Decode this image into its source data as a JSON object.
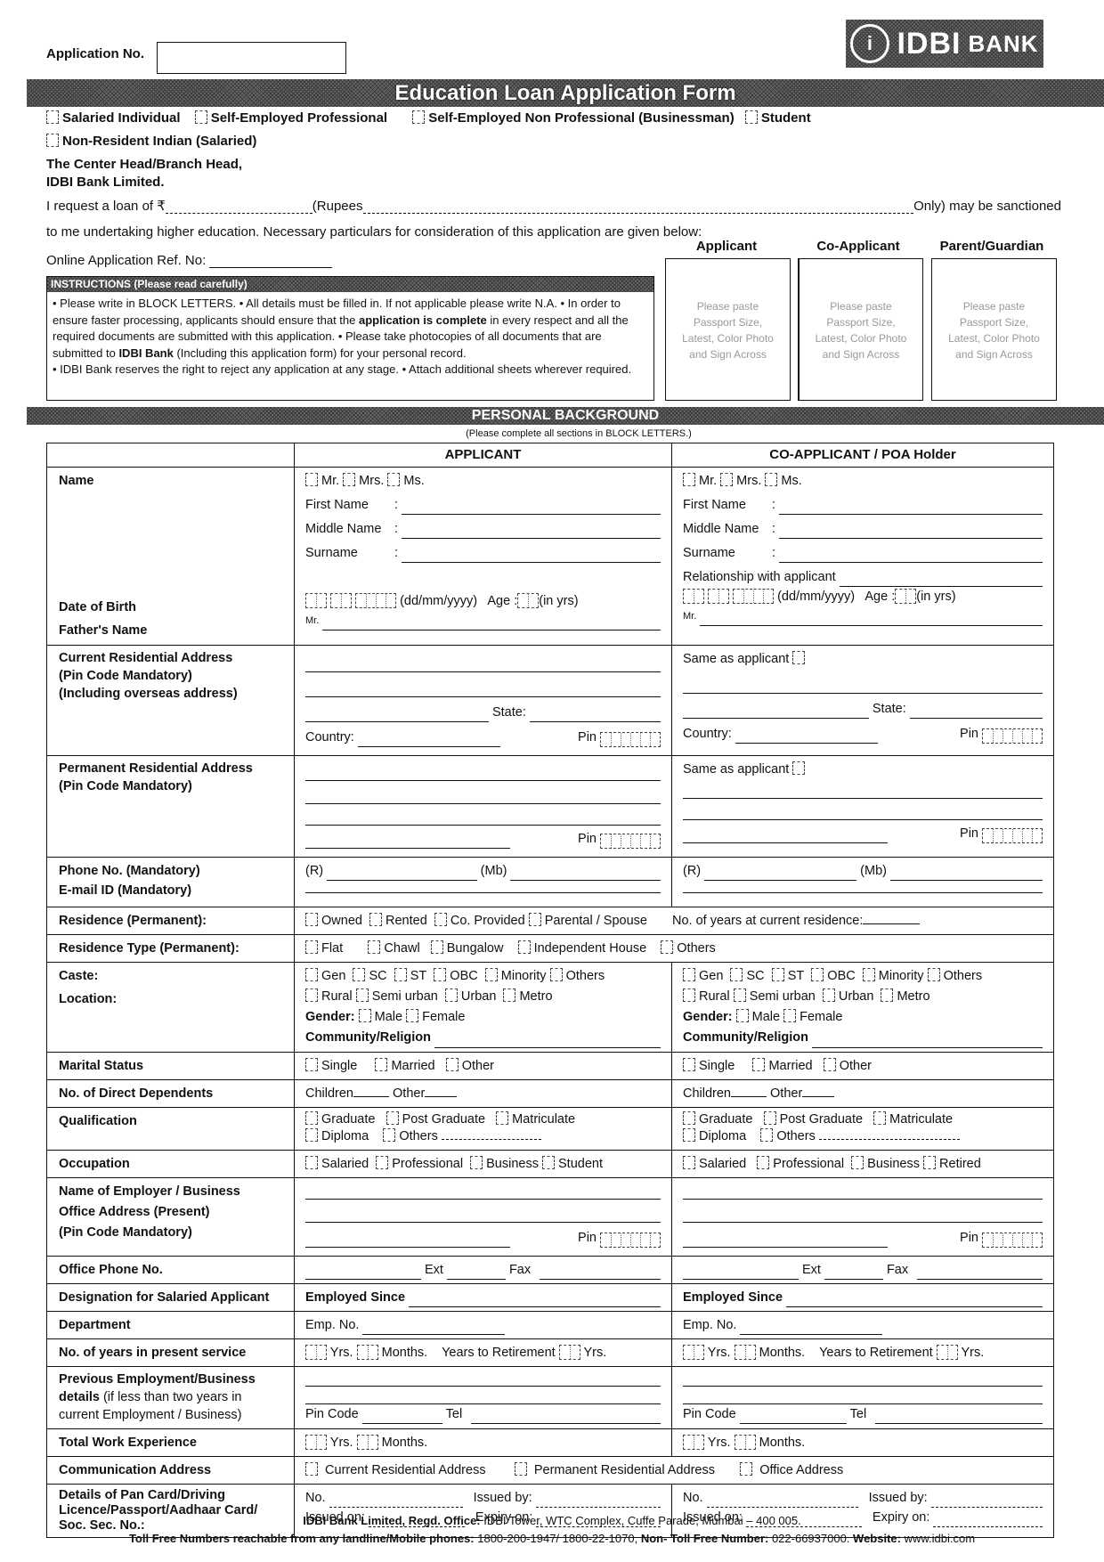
{
  "header": {
    "application_no_label": "Application No.",
    "logo_text": "IDBI",
    "logo_suffix": "BANK",
    "title": "Education Loan Application Form"
  },
  "applicant_types": [
    "Salaried Individual",
    "Self-Employed Professional",
    "Self-Employed Non Professional (Businessman)",
    "Student",
    "Non-Resident Indian (Salaried)"
  ],
  "addressee": {
    "line1": "The Center Head/Branch Head,",
    "line2": "IDBI Bank Limited."
  },
  "request": {
    "part1": "I request a loan of ₹",
    "part2": "(Rupees",
    "part3": "Only) may be sanctioned",
    "line2": "to me undertaking higher education. Necessary particulars for consideration of this application are given below:",
    "online_ref_label": "Online Application Ref. No:"
  },
  "photos": {
    "headers": [
      "Applicant",
      "Co-Applicant",
      "Parent/Guardian"
    ],
    "lines": [
      "Please paste",
      "Passport Size,",
      "Latest, Color Photo",
      "and Sign Across"
    ]
  },
  "instructions": {
    "title": "INSTRUCTIONS (Please read carefully)",
    "p1": "• Please write in BLOCK LETTERS. • All details must be filled in. If not applicable please write N.A. • In order to ensure faster processing, applicants should ensure that the ",
    "p1_bold": "application is complete",
    "p2": " in every respect and all the required documents are submitted with this application. • Please take photocopies of all documents that are submitted to ",
    "p2_bold": "IDBI Bank",
    "p3": " (Including this application form) for your personal record.",
    "p4": "• IDBI Bank reserves the right to reject any application at any stage.  • Attach additional sheets wherever required."
  },
  "section": {
    "title": "PERSONAL BACKGROUND",
    "note": "(Please complete all sections in BLOCK LETTERS.)"
  },
  "table": {
    "col_applicant": "APPLICANT",
    "col_coapplicant": "CO-APPLICANT / POA Holder",
    "labels": {
      "name": "Name",
      "dob": "Date of Birth",
      "father": "Father's Name",
      "cur_addr1": "Current Residential Address",
      "cur_addr2": "(Pin Code Mandatory)",
      "cur_addr3": "(Including overseas address)",
      "perm_addr1": "Permanent Residential Address",
      "perm_addr2": "(Pin Code Mandatory)",
      "phone": "Phone No. (Mandatory)",
      "email": "E-mail ID   (Mandatory)",
      "residence": "Residence (Permanent):",
      "residence_type": "Residence Type (Permanent):",
      "caste": "Caste:",
      "location": "Location:",
      "marital": "Marital Status",
      "dependents": "No. of Direct Dependents",
      "qualification": "Qualification",
      "occupation": "Occupation",
      "employer1": "Name of Employer / Business",
      "employer2": "Office Address (Present)",
      "employer3": "(Pin Code Mandatory)",
      "office_phone": "Office Phone No.",
      "designation": "Designation for Salaried Applicant",
      "department": "Department",
      "years_service": "No. of years in present service",
      "prev1": "Previous Employment/Business",
      "prev2_bold": "details",
      "prev2": " (if less than two years in",
      "prev3": "current Employment / Business)",
      "total_exp": "Total Work Experience",
      "comm_addr": "Communication Address",
      "pan1": "Details of Pan Card/Driving",
      "pan2": "Licence/Passport/Aadhaar Card/",
      "pan3": "Soc. Sec. No.:"
    },
    "fields": {
      "titles": [
        "Mr.",
        "Mrs.",
        "Ms."
      ],
      "first_name": "First Name",
      "middle_name": "Middle Name",
      "surname": "Surname",
      "colon": ":",
      "relationship": "Relationship with applicant",
      "date_format": "(dd/mm/yyyy)",
      "age": "Age :",
      "in_yrs": "(in yrs)",
      "mr": "Mr.",
      "state": "State:",
      "country": "Country:",
      "pin": "Pin",
      "same_as_applicant": "Same as applicant",
      "r": "(R)",
      "mb": "(Mb)",
      "residence_opts": [
        "Owned",
        "Rented",
        "Co. Provided",
        "Parental / Spouse"
      ],
      "years_residence": "No. of years at current residence:",
      "residence_type_opts": [
        "Flat",
        "Chawl",
        "Bungalow",
        "Independent House",
        "Others"
      ],
      "caste_opts": [
        "Gen",
        "SC",
        "ST",
        "OBC",
        "Minority",
        "Others"
      ],
      "location_opts": [
        "Rural",
        "Semi urban",
        "Urban",
        "Metro"
      ],
      "gender": "Gender:",
      "gender_opts": [
        "Male",
        "Female"
      ],
      "community": "Community/Religion",
      "marital_opts": [
        "Single",
        "Married",
        "Other"
      ],
      "children": "Children",
      "other": "Other",
      "qual_opts": [
        "Graduate",
        "Post Graduate",
        "Matriculate",
        "Diploma",
        "Others"
      ],
      "occ_applicant": [
        "Salaried",
        "Professional",
        "Business",
        "Student"
      ],
      "occ_coapplicant": [
        "Salaried",
        "Professional",
        "Business",
        "Retired"
      ],
      "ext": "Ext",
      "fax": "Fax",
      "employed_since": "Employed Since",
      "emp_no": "Emp. No.",
      "yrs": "Yrs.",
      "months": "Months.",
      "years_to_retirement": "Years to Retirement",
      "pin_code": "Pin Code",
      "tel": "Tel",
      "comm_opts": [
        "Current Residential Address",
        "Permanent  Residential Address",
        "Office Address"
      ],
      "no": "No.",
      "issued_by": "Issued by:",
      "issued_on": "Issued on:",
      "expiry_on": "Expiry on:"
    }
  },
  "footer": {
    "line1_bold": "IDBI Bank Limited, Regd. Office:",
    "line1": " IDBI Tower, WTC Complex, Cuffe Parade, Mumbai – 400 005.",
    "line2_bold1": "Toll Free Numbers reachable from any landline/Mobile phones:",
    "line2_a": " 1800-200-1947/ 1800-22-1070, ",
    "line2_bold2": "Non- Toll Free Number:",
    "line2_b": " 022-66937000. ",
    "line2_bold3": "Website:",
    "line2_c": " www.idbi.com"
  }
}
